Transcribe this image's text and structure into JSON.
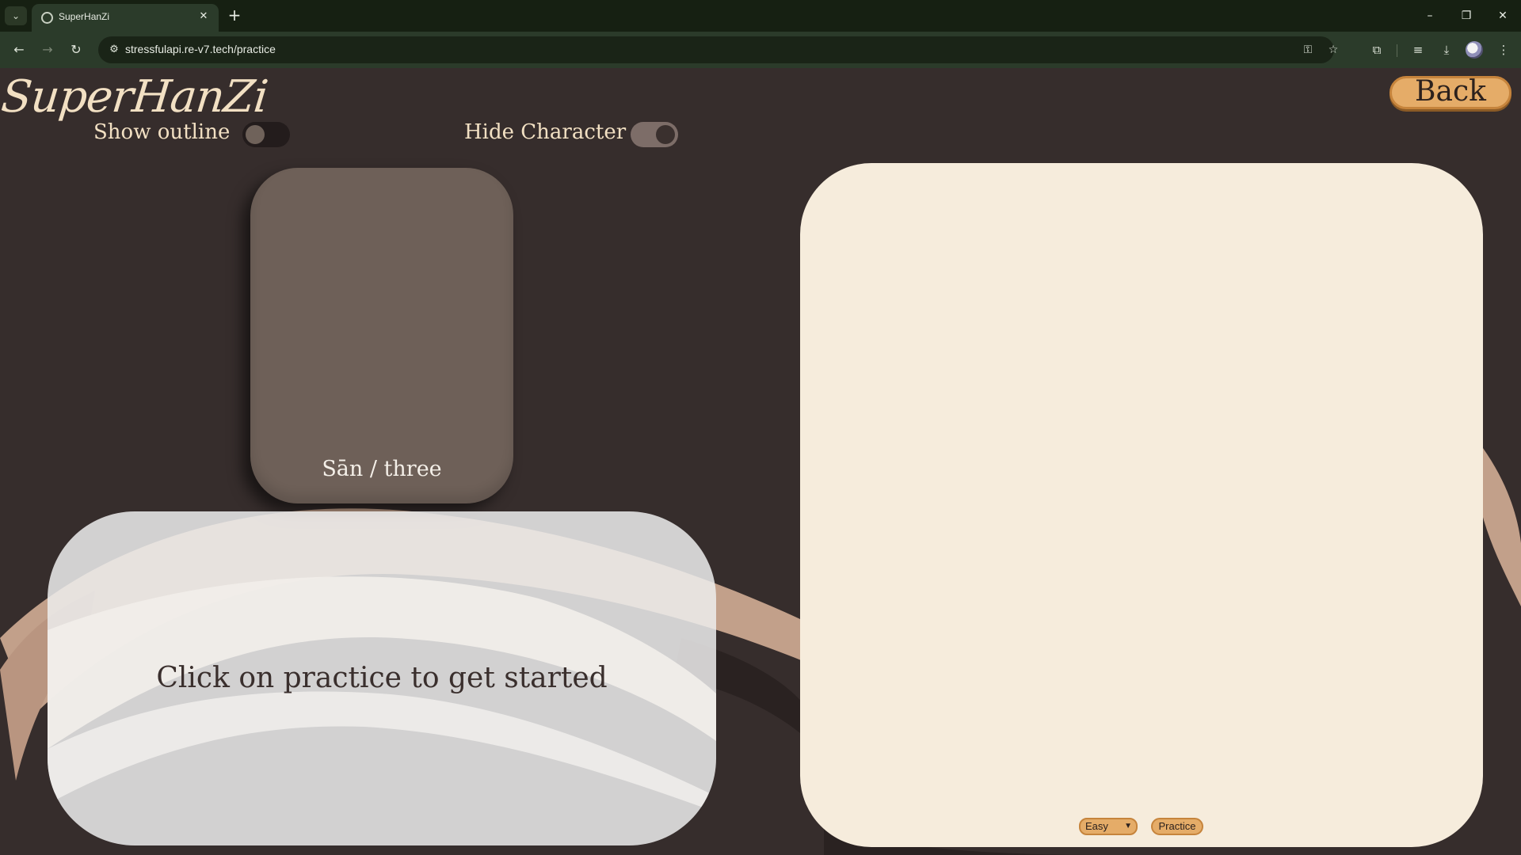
{
  "browser": {
    "tab_title": "SuperHanZi",
    "url": "stressfulapi.re-v7.tech/practice",
    "icons": [
      "tab-list-icon",
      "globe-icon",
      "close-icon",
      "plus-icon",
      "minimize-icon",
      "restore-icon",
      "back-arrow-icon",
      "forward-arrow-icon",
      "reload-icon",
      "site-info-icon",
      "key-icon",
      "star-icon",
      "extensions-icon",
      "media-icon",
      "download-icon",
      "avatar",
      "kebab-menu-icon"
    ]
  },
  "app": {
    "logo": "SuperHanZi",
    "back_label": "Back"
  },
  "toggles": {
    "show_outline": {
      "label": "Show outline",
      "on": false
    },
    "hide_character": {
      "label": "Hide Character",
      "on": true
    }
  },
  "character_card": {
    "meaning": "Sān / three"
  },
  "prompt": {
    "text": "Click on practice to get started"
  },
  "controls": {
    "difficulty": "Easy",
    "practice_label": "Practice"
  },
  "colors": {
    "background": "#362d2c",
    "accent": "#e5ac68",
    "card": "#6e6058",
    "canvas": "#f6ecdc",
    "brush": "#c2a08a"
  }
}
